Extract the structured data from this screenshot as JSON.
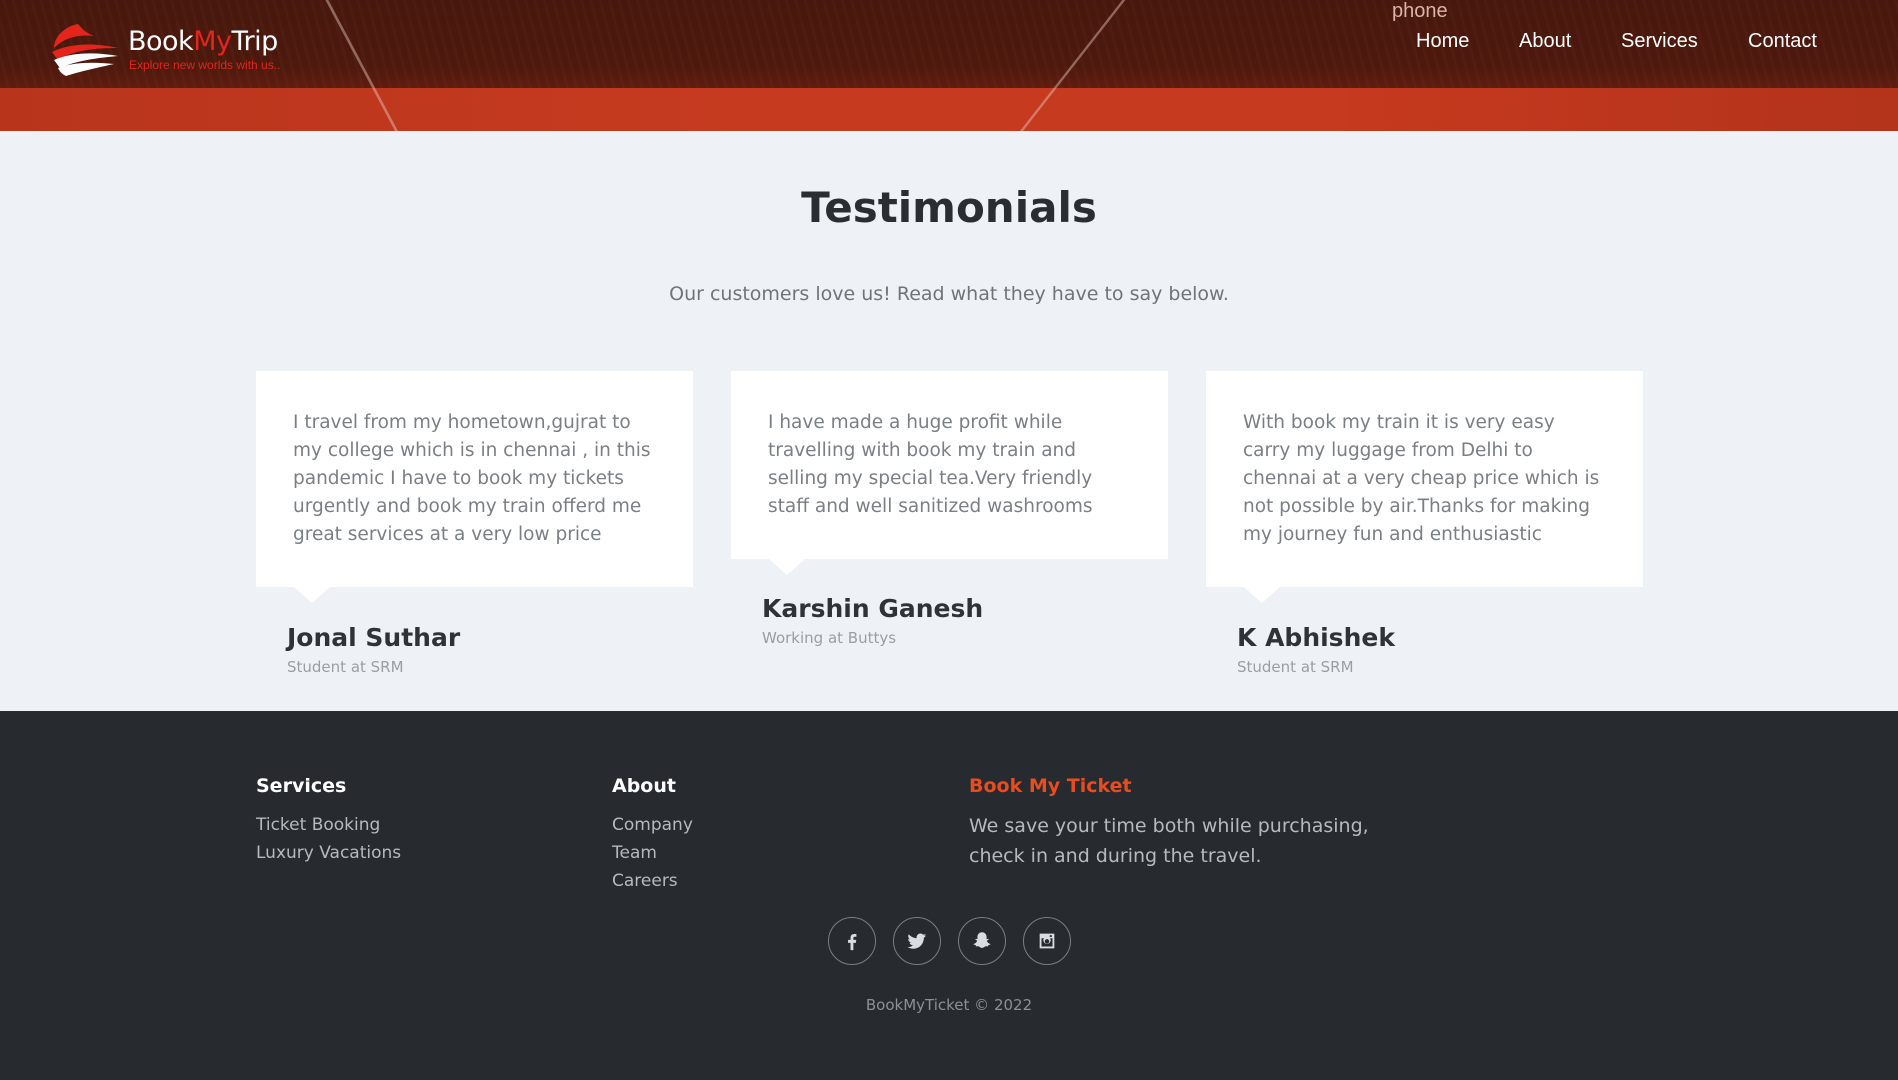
{
  "header": {
    "brand_book": "Book",
    "brand_my": "My",
    "brand_trip": "Trip",
    "tagline": "Explore new worlds with us..",
    "phone_label": "phone",
    "nav": {
      "home": "Home",
      "about": "About",
      "services": "Services",
      "contact": "Contact"
    }
  },
  "testimonials": {
    "title": "Testimonials",
    "subtitle": "Our customers love us! Read what they have to say below.",
    "items": [
      {
        "text": "I travel from my hometown,gujrat to my college which is in chennai , in this pandemic I have to book my tickets urgently and book my train offerd me great services at a very low price",
        "name": "Jonal Suthar",
        "role": "Student at SRM"
      },
      {
        "text": "I have made a huge profit while travelling with book my train and selling my special tea.Very friendly staff and well sanitized washrooms",
        "name": "Karshin Ganesh",
        "role": "Working at Buttys"
      },
      {
        "text": "With book my train it is very easy carry my luggage from Delhi to chennai at a very cheap price which is not possible by air.Thanks for making my journey fun and enthusiastic",
        "name": "K Abhishek",
        "role": "Student at SRM"
      }
    ]
  },
  "footer": {
    "services": {
      "heading": "Services",
      "links": [
        "Ticket Booking",
        "Luxury Vacations"
      ]
    },
    "about": {
      "heading": "About",
      "links": [
        "Company",
        "Team",
        "Careers"
      ]
    },
    "brand": {
      "heading": "Book My Ticket",
      "text": "We save your time both while purchasing, check in and during the travel."
    },
    "socials": [
      "facebook-icon",
      "twitter-icon",
      "snapchat-icon",
      "instagram-icon"
    ],
    "copyright": "BookMyTicket © 2022"
  },
  "colors": {
    "accent": "#ea4c1e",
    "brand_red": "#e3251b",
    "footer_bg": "#272b30",
    "section_bg": "#eef2f6"
  }
}
